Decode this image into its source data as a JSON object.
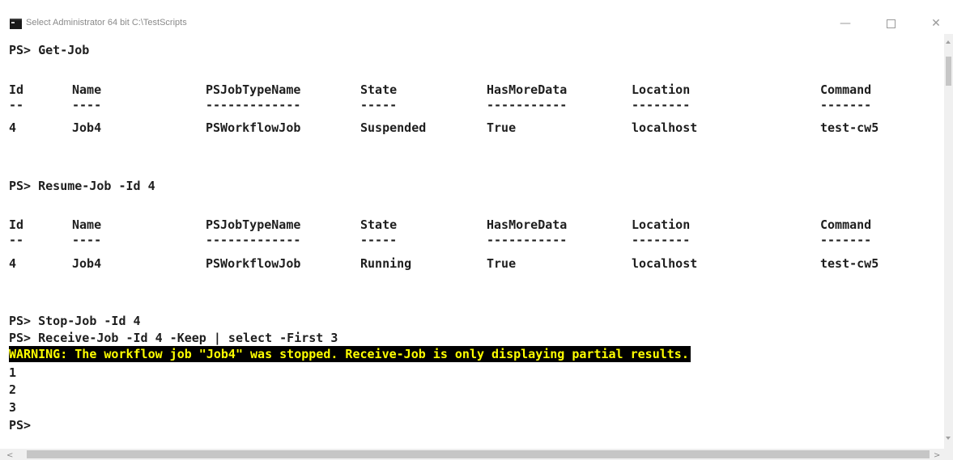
{
  "window": {
    "title": "Select Administrator 64 bit C:\\TestScripts",
    "icons": [
      "console-app-icon",
      "minimize-icon",
      "maximize-icon",
      "close-icon"
    ],
    "minimize_glyph": "—",
    "close_glyph": "✕"
  },
  "console": {
    "prompt_get_job": "PS> Get-Job",
    "prompt_resume_job": "PS> Resume-Job -Id 4",
    "prompt_stop_job": "PS> Stop-Job -Id 4",
    "prompt_receive_job": "PS> Receive-Job -Id 4 -Keep | select -First 3",
    "warning": "WARNING: The workflow job \"Job4\" was stopped. Receive-Job is only displaying partial results.",
    "output_lines": [
      "1",
      "2",
      "3"
    ],
    "final_prompt": "PS>",
    "colors": {
      "background": "#ffffff",
      "text": "#1e1e1e",
      "warning_background": "#000000",
      "warning_text": "#ffff00"
    }
  },
  "table_headers": [
    "Id",
    "Name",
    "PSJobTypeName",
    "State",
    "HasMoreData",
    "Location",
    "Command"
  ],
  "table_dashes": [
    "--",
    "----",
    "-------------",
    "-----",
    "-----------",
    "--------",
    "-------"
  ],
  "get_job_table": {
    "rows": [
      [
        "4",
        "Job4",
        "PSWorkflowJob",
        "Suspended",
        "True",
        "localhost",
        "test-cw5"
      ]
    ]
  },
  "resume_job_table": {
    "rows": [
      [
        "4",
        "Job4",
        "PSWorkflowJob",
        "Running",
        "True",
        "localhost",
        "test-cw5"
      ]
    ]
  },
  "scrollbars": {
    "left_arrow": "<",
    "right_arrow": ">"
  }
}
